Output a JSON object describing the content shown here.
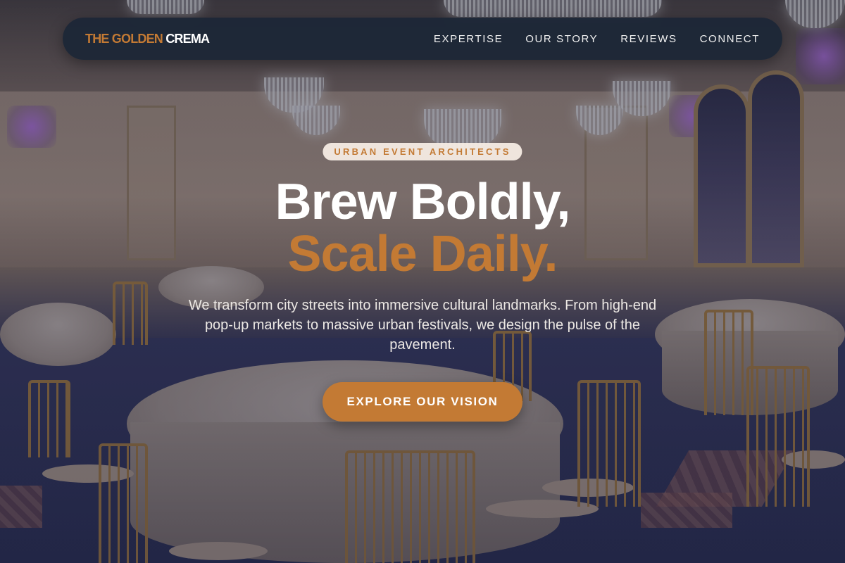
{
  "brand": {
    "name_accent": "THE GOLDEN",
    "name_rest": "CREMA",
    "accent_color": "#c37a34"
  },
  "nav": {
    "items": [
      {
        "label": "EXPERTISE"
      },
      {
        "label": "OUR STORY"
      },
      {
        "label": "REVIEWS"
      },
      {
        "label": "CONNECT"
      }
    ]
  },
  "hero": {
    "badge": "URBAN EVENT ARCHITECTS",
    "headline_line1": "Brew Boldly,",
    "headline_line2": "Scale Daily.",
    "description": "We transform city streets into immersive cultural landmarks. From high-end pop-up markets to massive urban festivals, we design the pulse of the pavement.",
    "cta_label": "EXPLORE OUR VISION"
  },
  "colors": {
    "accent": "#c37a34",
    "navbar": "#1b2636",
    "text_light": "#ffffff"
  }
}
